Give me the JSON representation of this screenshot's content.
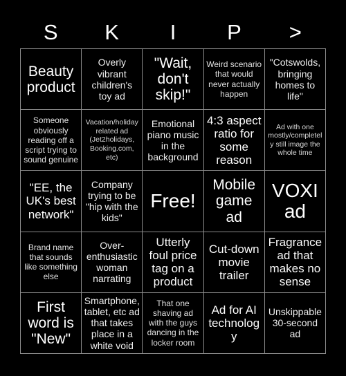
{
  "card": {
    "title": "SKIP",
    "header_letters": [
      "S",
      "K",
      "I",
      "P",
      ">"
    ],
    "colors": {
      "background": "#000000",
      "border": "#8d8d8d",
      "text": "#ffffff"
    },
    "rows": 5,
    "columns": 5,
    "cells": [
      {
        "text": "Beauty product",
        "size": "xl"
      },
      {
        "text": "Overly vibrant children's toy ad",
        "size": "md"
      },
      {
        "text": "\"Wait, don't skip!\"",
        "size": "xl"
      },
      {
        "text": "Weird scenario that would never actually happen",
        "size": "sm"
      },
      {
        "text": "\"Cotswolds, bringing homes to life\"",
        "size": "md"
      },
      {
        "text": "Someone obviously reading off a script trying to sound genuine",
        "size": "sm"
      },
      {
        "text": "Vacation/holiday related ad (Jet2holidays, Booking.com, etc)",
        "size": "xs"
      },
      {
        "text": "Emotional piano music in the background",
        "size": "md"
      },
      {
        "text": "4:3 aspect ratio for some reason",
        "size": "lg"
      },
      {
        "text": "Ad with one mostly/completely still image the whole time",
        "size": "xs"
      },
      {
        "text": "\"EE, the UK's best network\"",
        "size": "lg"
      },
      {
        "text": "Company trying to be \"hip with the kids\"",
        "size": "md"
      },
      {
        "text": "Free!",
        "size": "xxl"
      },
      {
        "text": "Mobile game ad",
        "size": "xl"
      },
      {
        "text": "VOXI ad",
        "size": "xxl"
      },
      {
        "text": "Brand name that sounds like something else",
        "size": "sm"
      },
      {
        "text": "Over-enthusiastic woman narrating",
        "size": "md"
      },
      {
        "text": "Utterly foul price tag on a product",
        "size": "lg"
      },
      {
        "text": "Cut-down movie trailer",
        "size": "lg"
      },
      {
        "text": "Fragrance ad that makes no sense",
        "size": "lg"
      },
      {
        "text": "First word is \"New\"",
        "size": "xl"
      },
      {
        "text": "Smartphone, tablet, etc ad that takes place in a white void",
        "size": "md"
      },
      {
        "text": "That one shaving ad with the guys dancing in the locker room",
        "size": "sm"
      },
      {
        "text": "Ad for AI technology",
        "size": "lg"
      },
      {
        "text": "Unskippable 30-second ad",
        "size": "md"
      }
    ]
  }
}
